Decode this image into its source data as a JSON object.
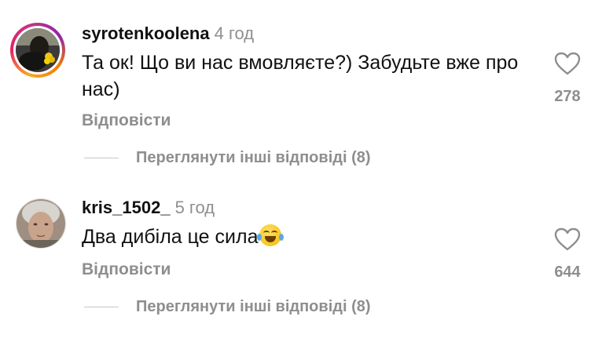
{
  "comments": [
    {
      "username": "syrotenkoolena",
      "time": "4 год",
      "text": "Та ок! Що ви нас вмовляєте?) Забудьте вже про нас)",
      "reply_label": "Відповісти",
      "like_count": "278",
      "more_replies": "Переглянути інші відповіді (8)",
      "has_story_ring": true
    },
    {
      "username": "kris_1502_",
      "time": "5 год",
      "text": "Два дибіла це сила",
      "emoji": "laughing-tears-emoji",
      "reply_label": "Відповісти",
      "like_count": "644",
      "more_replies": "Переглянути інші відповіді (8)",
      "has_story_ring": false
    }
  ],
  "colors": {
    "secondary_text": "#8e8e8e",
    "primary_text": "#111111",
    "divider": "#c7c7c7"
  }
}
